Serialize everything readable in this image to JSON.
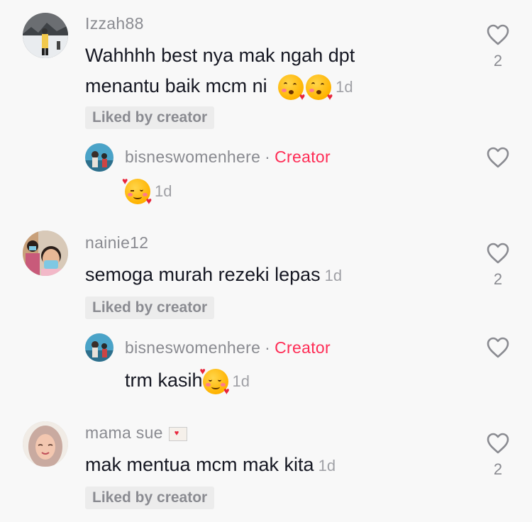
{
  "comments": [
    {
      "username": "Izzah88",
      "text_line1": "Wahhhh best nya mak ngah dpt",
      "text_line2": "menantu baik mcm ni",
      "time": "1d",
      "liked_label": "Liked by creator",
      "like_count": "2",
      "avatar": "snow-photo-avatar",
      "emojis": [
        "kissing-heart-emoji",
        "kissing-heart-emoji"
      ],
      "reply": {
        "username": "bisneswomenhere",
        "separator": "·",
        "creator_label": "Creator",
        "text": "",
        "emojis": [
          "smiling-hearts-emoji"
        ],
        "time": "1d",
        "avatar": "beach-photo-avatar"
      }
    },
    {
      "username": "nainie12",
      "text_line1": "semoga murah rezeki lepas",
      "time": "1d",
      "liked_label": "Liked by creator",
      "like_count": "2",
      "avatar": "masked-people-avatar",
      "reply": {
        "username": "bisneswomenhere",
        "separator": "·",
        "creator_label": "Creator",
        "text": "trm kasih",
        "emojis": [
          "smiling-hearts-emoji"
        ],
        "time": "1d",
        "avatar": "beach-photo-avatar"
      }
    },
    {
      "username": "mama sue",
      "username_icon": "love-letter-icon",
      "text_line1": "mak mentua mcm mak kita",
      "time": "1d",
      "liked_label": "Liked by creator",
      "like_count": "2",
      "avatar": "hijab-woman-avatar"
    }
  ],
  "colors": {
    "background": "#f8f8f8",
    "text": "#161823",
    "muted": "#8a8b91",
    "creator": "#fe2c55",
    "liked_bg": "#ececec"
  }
}
